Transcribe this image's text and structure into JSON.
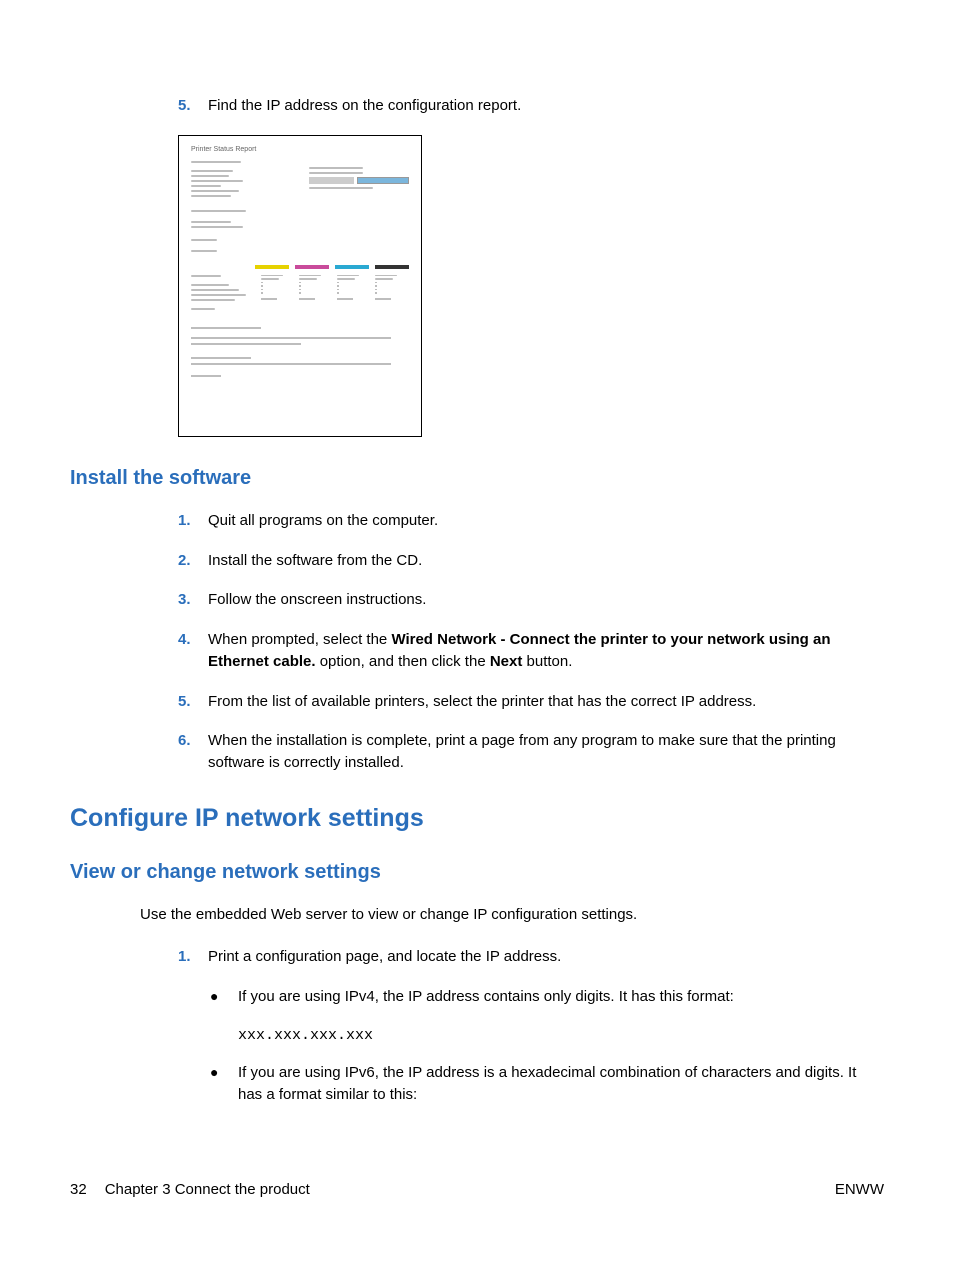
{
  "top": {
    "num": "5.",
    "text": "Find the IP address on the configuration report."
  },
  "figure": {
    "title": "Printer Status Report"
  },
  "h_install": "Install the software",
  "install_steps": [
    {
      "n": "1.",
      "t": "Quit all programs on the computer."
    },
    {
      "n": "2.",
      "t": "Install the software from the CD."
    },
    {
      "n": "3.",
      "t": "Follow the onscreen instructions."
    },
    {
      "n": "4.",
      "pre": "When prompted, select the ",
      "b1": "Wired Network - Connect the printer to your network using an Ethernet cable.",
      "mid": " option, and then click the ",
      "b2": "Next",
      "post": " button."
    },
    {
      "n": "5.",
      "t": "From the list of available printers, select the printer that has the correct IP address."
    },
    {
      "n": "6.",
      "t": "When the installation is complete, print a page from any program to make sure that the printing software is correctly installed."
    }
  ],
  "h_configure": "Configure IP network settings",
  "h_view": "View or change network settings",
  "view_intro": "Use the embedded Web server to view or change IP configuration settings.",
  "view_step1": {
    "n": "1.",
    "t": "Print a configuration page, and locate the IP address."
  },
  "bullets": {
    "ipv4": "If you are using IPv4, the IP address contains only digits. It has this format:",
    "ipv4_fmt": "xxx.xxx.xxx.xxx",
    "ipv6": "If you are using IPv6, the IP address is a hexadecimal combination of characters and digits. It has a format similar to this:"
  },
  "footer": {
    "page": "32",
    "chapter": "Chapter 3   Connect the product",
    "right": "ENWW"
  }
}
